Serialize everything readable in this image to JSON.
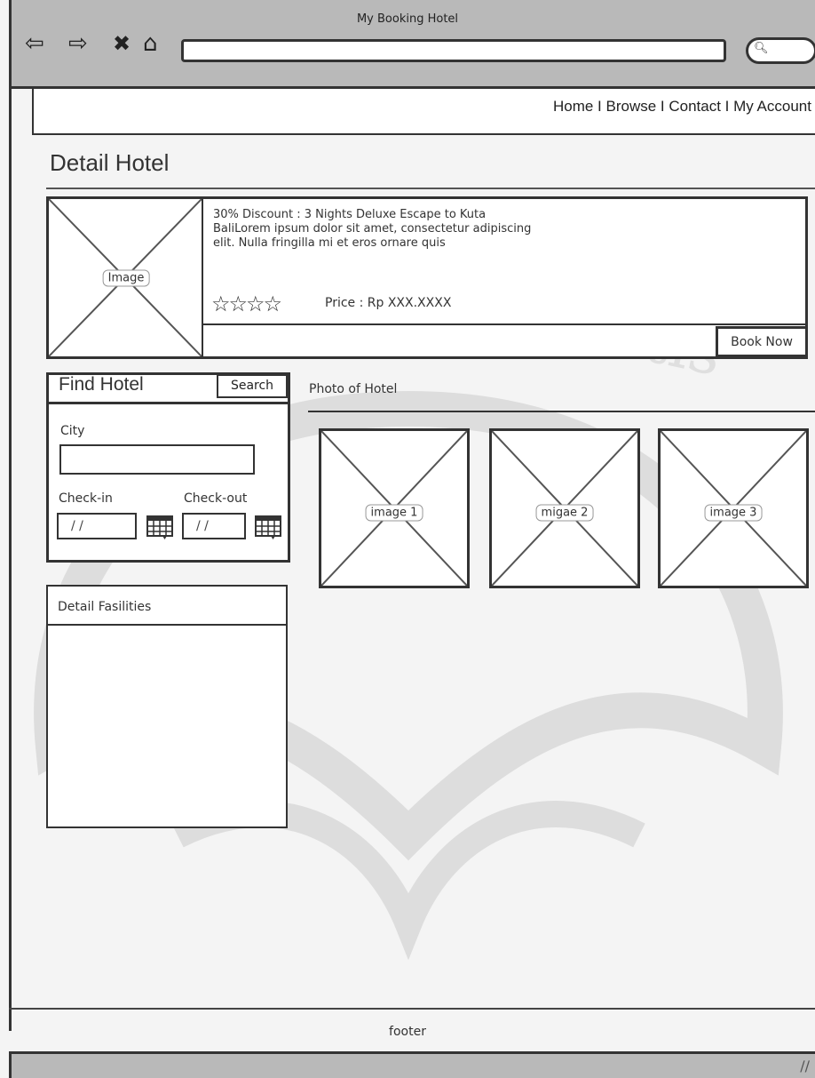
{
  "window": {
    "title": "My Booking Hotel"
  },
  "nav": {
    "items": [
      "Home",
      "Browse",
      "Contact",
      "My Account"
    ],
    "text": "Home I Browse I Contact I My Account"
  },
  "page": {
    "title": "Detail Hotel"
  },
  "promo": {
    "image_label": "Image",
    "line1": "30% Discount : 3 Nights Deluxe Escape to Kuta",
    "line2": "BaliLorem ipsum dolor sit amet, consectetur adipiscing",
    "line3": "elit. Nulla fringilla mi et eros ornare quis",
    "stars": "☆☆☆☆",
    "star_rating": 0,
    "price": "Price : Rp XXX.XXXX",
    "book_label": "Book Now"
  },
  "find_hotel": {
    "title": "Find Hotel",
    "search_label": "Search",
    "city_label": "City",
    "city_value": "",
    "checkin_label": "Check-in",
    "checkin_value": "/ /",
    "checkout_label": "Check-out",
    "checkout_value": "/ /"
  },
  "facilities": {
    "title": "Detail Fasilities"
  },
  "photos": {
    "title": "Photo of Hotel",
    "items": [
      {
        "label": "image 1"
      },
      {
        "label": "migae 2"
      },
      {
        "label": "image 3"
      }
    ]
  },
  "footer": {
    "text": "footer"
  },
  "watermark": {
    "text": "lumine veritatis"
  }
}
